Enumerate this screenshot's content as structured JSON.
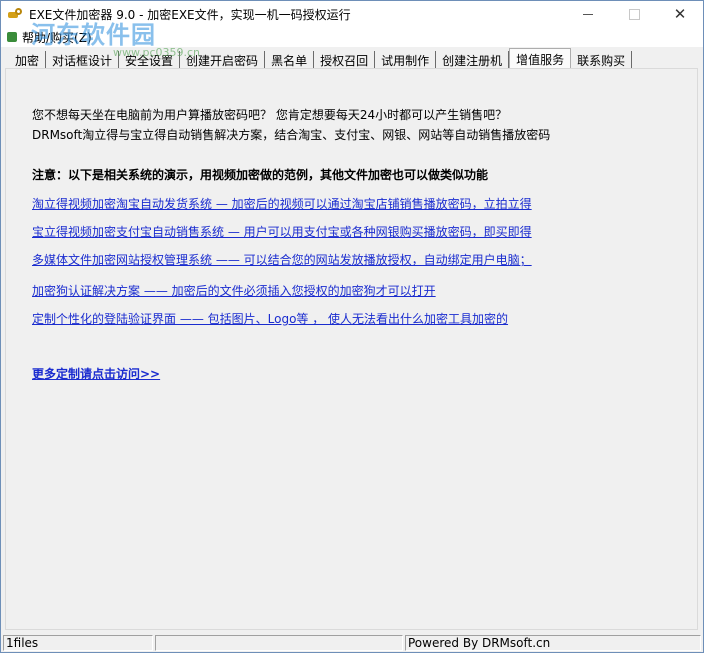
{
  "window": {
    "title": "EXE文件加密器 9.0 - 加密EXE文件，实现一机一码授权运行",
    "controls": {
      "minimize": "minimize",
      "maximize": "maximize",
      "close": "✕"
    }
  },
  "watermark": {
    "text": "河东软件园",
    "url": "www.pc0359.cn"
  },
  "menubar": {
    "items": [
      {
        "label": "帮助/购买(Z)",
        "icon": "help-icon"
      }
    ]
  },
  "tabs": [
    {
      "label": "加密",
      "active": false
    },
    {
      "label": "对话框设计",
      "active": false
    },
    {
      "label": "安全设置",
      "active": false
    },
    {
      "label": "创建开启密码",
      "active": false
    },
    {
      "label": "黑名单",
      "active": false
    },
    {
      "label": "授权召回",
      "active": false
    },
    {
      "label": "试用制作",
      "active": false
    },
    {
      "label": "创建注册机",
      "active": false
    },
    {
      "label": "增值服务",
      "active": true
    },
    {
      "label": "联系购买",
      "active": false
    }
  ],
  "content": {
    "intro_line1": "您不想每天坐在电脑前为用户算播放密码吧？ 您肯定想要每天24小时都可以产生销售吧？",
    "intro_line2": "DRMsoft淘立得与宝立得自动销售解决方案，结合淘宝、支付宝、网银、网站等自动销售播放密码",
    "notice": "注意：以下是相关系统的演示，用视频加密做的范例，其他文件加密也可以做类似功能",
    "links": [
      "淘立得视频加密淘宝自动发货系统 — 加密后的视频可以通过淘宝店铺销售播放密码，立拍立得",
      "宝立得视频加密支付宝自动销售系统 — 用户可以用支付宝或各种网银购买播放密码，即买即得",
      "多媒体文件加密网站授权管理系统 —— 可以结合您的网站发放播放授权，自动绑定用户电脑；",
      "加密狗认证解决方案 —— 加密后的文件必须插入您授权的加密狗才可以打开",
      "定制个性化的登陆验证界面 ——  包括图片、Logo等 ， 使人无法看出什么加密工具加密的"
    ],
    "more_link": "更多定制请点击访问>>"
  },
  "statusbar": {
    "files": "1files",
    "middle": "",
    "powered": "Powered By DRMsoft.cn"
  }
}
